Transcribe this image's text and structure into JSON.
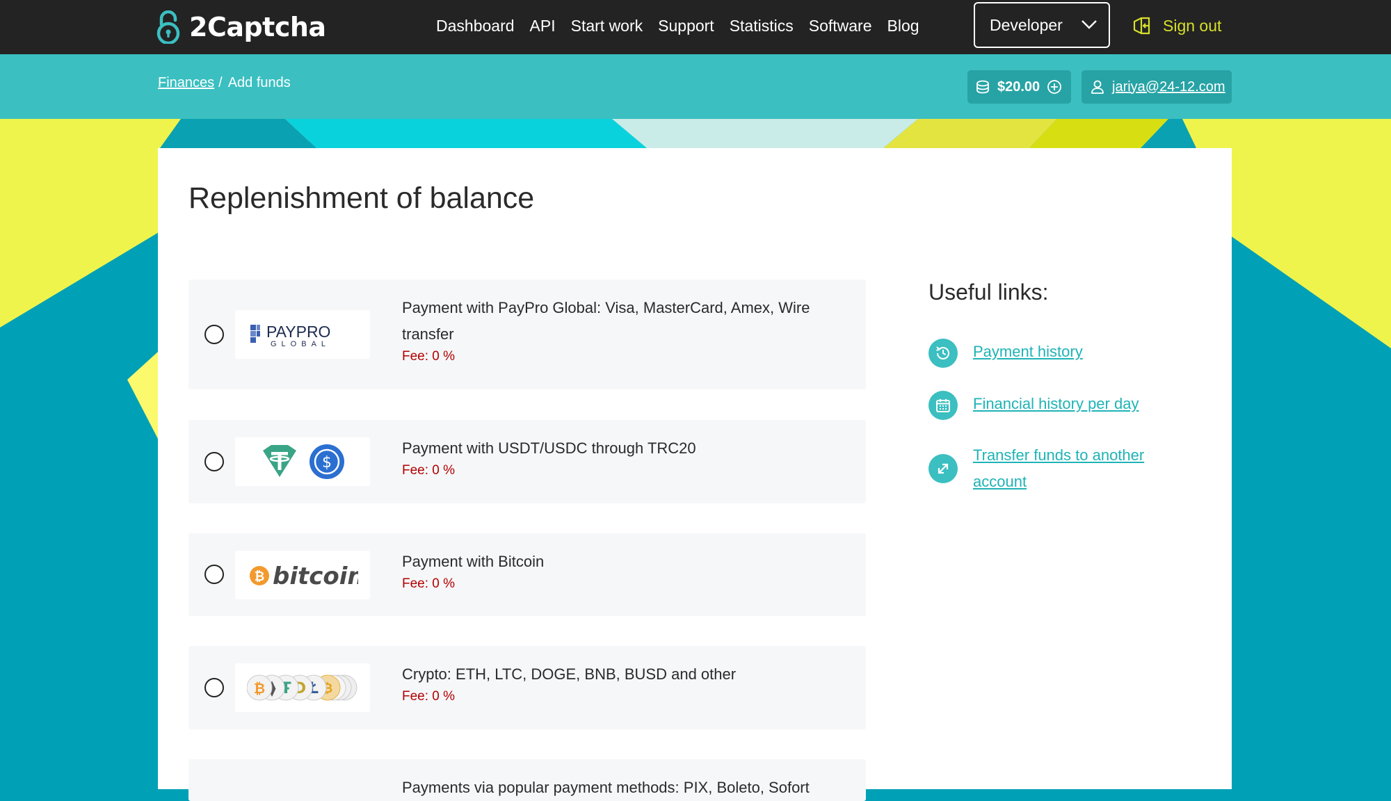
{
  "brand": {
    "name": "2Captcha"
  },
  "nav": {
    "items": [
      {
        "label": "Dashboard"
      },
      {
        "label": "API"
      },
      {
        "label": "Start work"
      },
      {
        "label": "Support"
      },
      {
        "label": "Statistics"
      },
      {
        "label": "Software"
      },
      {
        "label": "Blog"
      }
    ],
    "role_select": "Developer",
    "sign_out": "Sign out"
  },
  "subbar": {
    "breadcrumb": {
      "parent": "Finances",
      "separator": "/",
      "current": "Add funds"
    },
    "balance": "$20.00",
    "user_email": "jariya@24-12.com"
  },
  "page": {
    "title": "Replenishment of balance"
  },
  "payment_methods": [
    {
      "logo": "paypro-global-logo",
      "logo_text": "PAYPRO",
      "logo_subtext": "GLOBAL",
      "label": "Payment with PayPro Global: Visa, MasterCard, Amex, Wire transfer",
      "fee": "Fee: 0 %"
    },
    {
      "logo": "tether-usdc-logo",
      "label": "Payment with USDT/USDC through TRC20",
      "fee": "Fee: 0 %"
    },
    {
      "logo": "bitcoin-logo",
      "logo_text": "bitcoin",
      "label": "Payment with Bitcoin",
      "fee": "Fee: 0 %"
    },
    {
      "logo": "crypto-coins-logo",
      "label": "Crypto: ETH, LTC, DOGE, BNB, BUSD and other",
      "fee": "Fee: 0 %"
    },
    {
      "label": "Payments via popular payment methods: PIX, Boleto, Sofort"
    }
  ],
  "useful_links": {
    "title": "Useful links:",
    "items": [
      {
        "label": "Payment history",
        "icon": "history-icon"
      },
      {
        "label": "Financial history per day",
        "icon": "calendar-icon"
      },
      {
        "label": "Transfer funds to another account",
        "icon": "transfer-icon"
      }
    ]
  },
  "colors": {
    "topbar": "#232323",
    "subbar": "#3bbfc1",
    "accent_teal": "#00a0b6",
    "accent_yellow": "#eef44c",
    "sign_out": "#d6e02a",
    "fee_text": "#b20000",
    "link": "#1fb3b6"
  }
}
